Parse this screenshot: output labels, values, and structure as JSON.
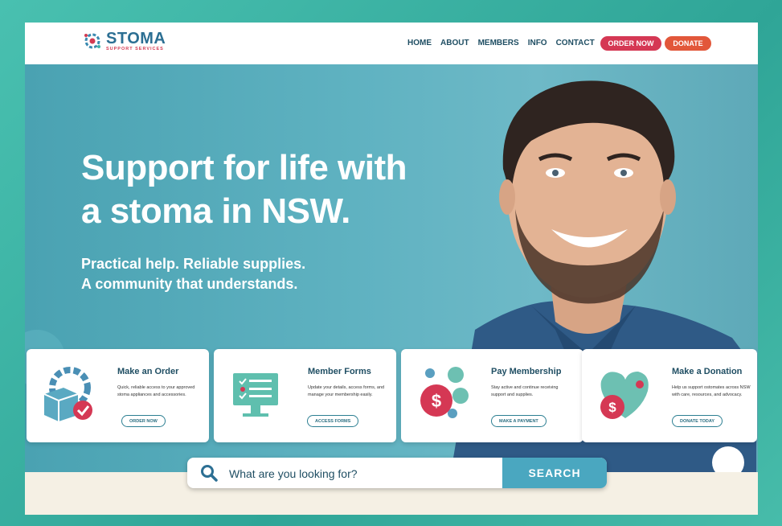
{
  "brand": {
    "title": "STOMA",
    "subtitle": "SUPPORT SERVICES"
  },
  "nav": {
    "items": [
      "HOME",
      "ABOUT",
      "MEMBERS",
      "INFO",
      "CONTACT"
    ],
    "order_label": "ORDER NOW",
    "donate_label": "DONATE"
  },
  "hero": {
    "headline_line1": "Support for life with",
    "headline_line2": "a stoma in NSW.",
    "sub_line1": "Practical help. Reliable supplies.",
    "sub_line2": "A community that understands."
  },
  "cards": [
    {
      "title": "Make an Order",
      "desc": "Quick, reliable access to your approved stoma appliances and accessories.",
      "button": "ORDER NOW",
      "icon": "box-gear-icon"
    },
    {
      "title": "Member Forms",
      "desc": "Update your details, access forms, and manage your membership easily.",
      "button": "ACCESS FORMS",
      "icon": "monitor-form-icon"
    },
    {
      "title": "Pay Membership",
      "desc": "Stay active and continue receiving support and supplies.",
      "button": "MAKE A PAYMENT",
      "icon": "dollar-coin-icon"
    },
    {
      "title": "Make a Donation",
      "desc": "Help us support ostomates across NSW with care, resources, and advocacy.",
      "button": "DONATE TODAY",
      "icon": "heart-dollar-icon"
    }
  ],
  "search": {
    "placeholder": "What are you looking for?",
    "button": "SEARCH"
  },
  "colors": {
    "primary": "#1f4e63",
    "accent_red": "#d53854",
    "accent_orange": "#e2573a",
    "hero_teal": "#5fb2c1",
    "frame_teal": "#3fb5a6"
  }
}
